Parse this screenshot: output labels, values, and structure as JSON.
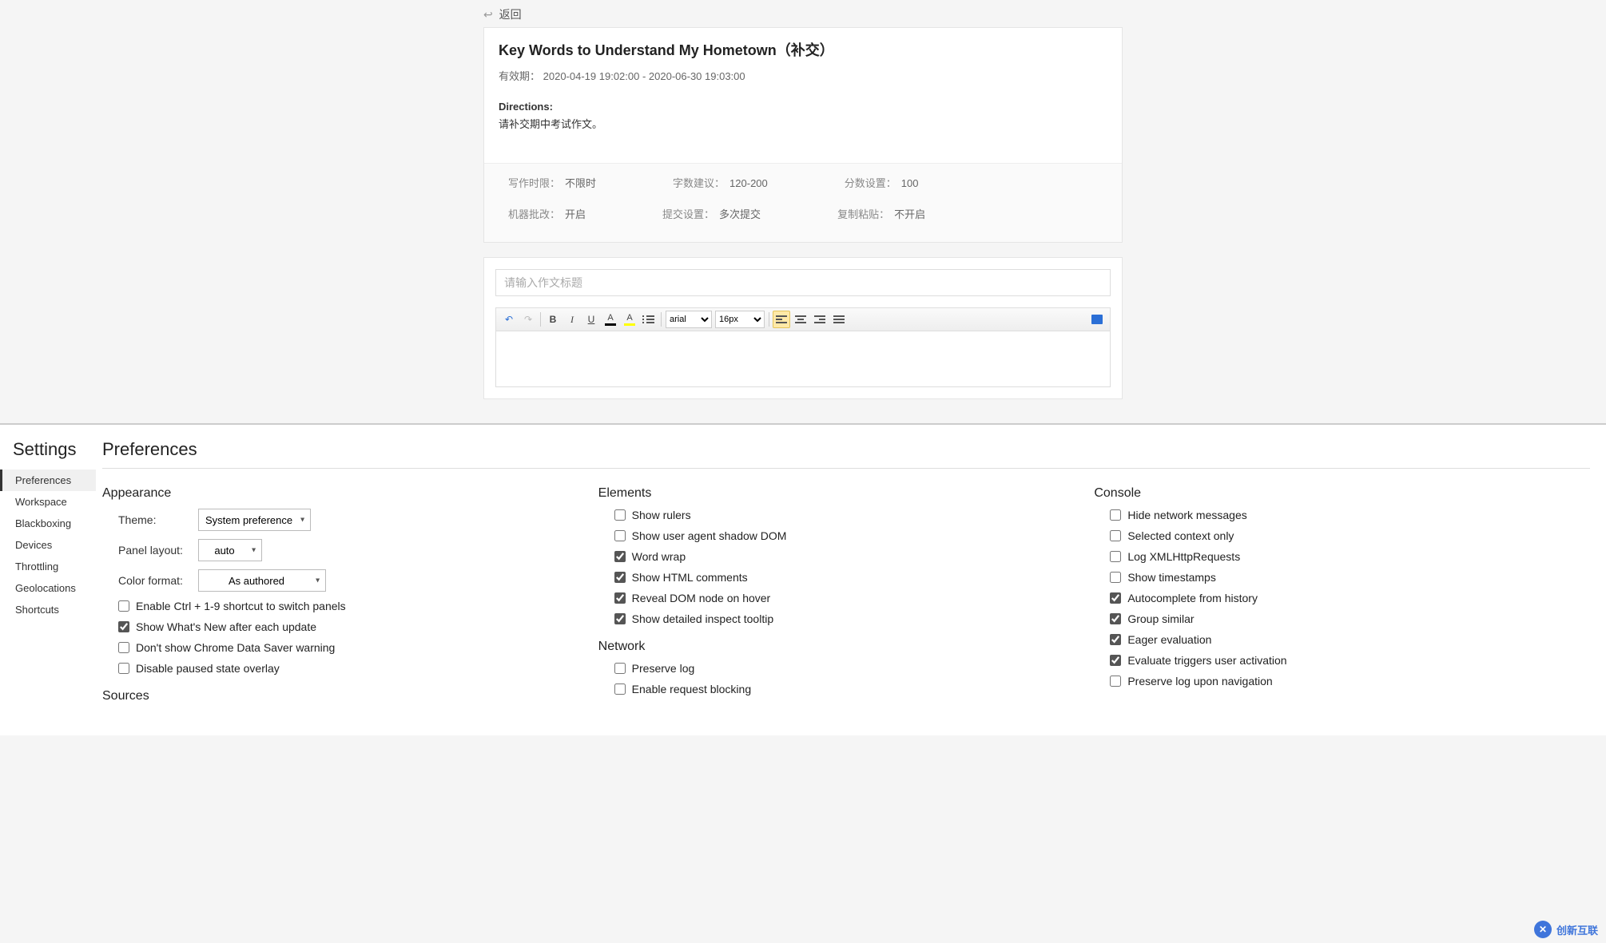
{
  "back_label": "返回",
  "assignment": {
    "title": "Key Words to Understand My Hometown（补交）",
    "validity_label": "有效期：",
    "validity_value": "2020-04-19 19:02:00 - 2020-06-30 19:03:00",
    "directions_label": "Directions:",
    "directions_body": "请补交期中考试作文。",
    "meta": [
      {
        "label": "写作时限：",
        "value": "不限时"
      },
      {
        "label": "字数建议：",
        "value": "120-200"
      },
      {
        "label": "分数设置：",
        "value": "100"
      },
      {
        "label": "机器批改：",
        "value": "开启"
      },
      {
        "label": "提交设置：",
        "value": "多次提交"
      },
      {
        "label": "复制粘贴：",
        "value": "不开启"
      }
    ]
  },
  "editor": {
    "title_placeholder": "请输入作文标题",
    "font_value": "arial",
    "size_value": "16px"
  },
  "devtools": {
    "settings_title": "Settings",
    "nav": [
      "Preferences",
      "Workspace",
      "Blackboxing",
      "Devices",
      "Throttling",
      "Geolocations",
      "Shortcuts"
    ],
    "nav_active_index": 0,
    "page_title": "Preferences",
    "appearance": {
      "title": "Appearance",
      "theme_label": "Theme:",
      "theme_value": "System preference",
      "panel_layout_label": "Panel layout:",
      "panel_layout_value": "auto",
      "color_format_label": "Color format:",
      "color_format_value": "As authored",
      "checks": [
        {
          "label": "Enable Ctrl + 1-9 shortcut to switch panels",
          "checked": false
        },
        {
          "label": "Show What's New after each update",
          "checked": true
        },
        {
          "label": "Don't show Chrome Data Saver warning",
          "checked": false
        },
        {
          "label": "Disable paused state overlay",
          "checked": false
        }
      ]
    },
    "sources_title": "Sources",
    "elements": {
      "title": "Elements",
      "checks": [
        {
          "label": "Show rulers",
          "checked": false
        },
        {
          "label": "Show user agent shadow DOM",
          "checked": false
        },
        {
          "label": "Word wrap",
          "checked": true
        },
        {
          "label": "Show HTML comments",
          "checked": true
        },
        {
          "label": "Reveal DOM node on hover",
          "checked": true
        },
        {
          "label": "Show detailed inspect tooltip",
          "checked": true
        }
      ]
    },
    "network": {
      "title": "Network",
      "checks": [
        {
          "label": "Preserve log",
          "checked": false
        },
        {
          "label": "Enable request blocking",
          "checked": false
        }
      ]
    },
    "console": {
      "title": "Console",
      "checks": [
        {
          "label": "Hide network messages",
          "checked": false
        },
        {
          "label": "Selected context only",
          "checked": false
        },
        {
          "label": "Log XMLHttpRequests",
          "checked": false
        },
        {
          "label": "Show timestamps",
          "checked": false
        },
        {
          "label": "Autocomplete from history",
          "checked": true
        },
        {
          "label": "Group similar",
          "checked": true
        },
        {
          "label": "Eager evaluation",
          "checked": true
        },
        {
          "label": "Evaluate triggers user activation",
          "checked": true
        },
        {
          "label": "Preserve log upon navigation",
          "checked": false
        }
      ]
    }
  },
  "watermark_text": "创新互联"
}
